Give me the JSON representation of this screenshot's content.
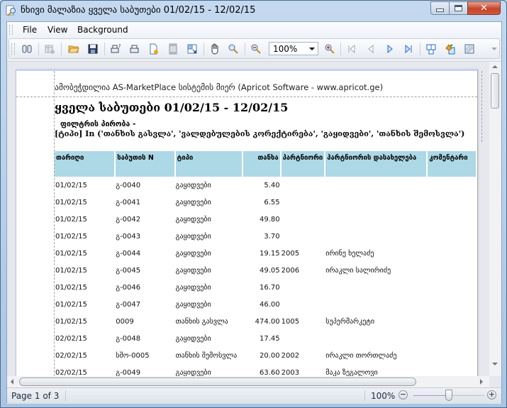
{
  "window": {
    "title": "ნხივი მალაზია ყველა საბუთები 01/02/15 - 12/02/15",
    "minimize_label": "minimize",
    "maximize_label": "maximize",
    "close_label": "✕"
  },
  "menu": {
    "items": [
      {
        "label": "File"
      },
      {
        "label": "View"
      },
      {
        "label": "Background"
      }
    ]
  },
  "toolbar": {
    "zoom_value": "100%",
    "icons": [
      "find-icon",
      "parameters-icon",
      "open-icon",
      "save-icon",
      "print-dialog-icon",
      "quick-print-icon",
      "page-setup-icon",
      "header-footer-icon",
      "scale-icon",
      "hand-tool-icon",
      "magnifier-icon",
      "zoom-out-icon",
      "zoom-in-icon",
      "first-page-icon",
      "previous-page-icon",
      "next-page-icon",
      "last-page-icon",
      "multiple-pages-icon",
      "background-color-icon",
      "watermark-icon"
    ]
  },
  "report": {
    "generated_by": "ამობეჭდილია AS-MarketPlace სისტემის მიერ (Apricot Software - www.apricot.ge)",
    "title": "ყველა საბუთები 01/02/15 - 12/02/15",
    "filter_label": "ფილტრის პირობა  -",
    "filter_expression": "[ტიპი] In ('თანხის გასვლა', 'ვალდებულების კორექტირება', 'გაყიდვები', 'თანხის შემოსვლა')",
    "columns": [
      "თარიღი",
      "საბუთის N",
      "ტიპი",
      "თანხა",
      "პარტნიორი",
      "პარტნიორის დასახელება",
      "კომენტარი"
    ],
    "rows": [
      {
        "date": "01/02/15",
        "doc_no": "გ-0040",
        "type": "გაყიდვები",
        "amount": "5.40",
        "partner": "",
        "partner_name": "",
        "comment": ""
      },
      {
        "date": "01/02/15",
        "doc_no": "გ-0041",
        "type": "გაყიდვები",
        "amount": "6.55",
        "partner": "",
        "partner_name": "",
        "comment": ""
      },
      {
        "date": "01/02/15",
        "doc_no": "გ-0042",
        "type": "გაყიდვები",
        "amount": "49.80",
        "partner": "",
        "partner_name": "",
        "comment": ""
      },
      {
        "date": "01/02/15",
        "doc_no": "გ-0043",
        "type": "გაყიდვები",
        "amount": "3.70",
        "partner": "",
        "partner_name": "",
        "comment": ""
      },
      {
        "date": "01/02/15",
        "doc_no": "გ-0044",
        "type": "გაყიდვები",
        "amount": "19.15",
        "partner": "2005",
        "partner_name": "ირინე ხელაძე",
        "comment": ""
      },
      {
        "date": "01/02/15",
        "doc_no": "გ-0045",
        "type": "გაყიდვები",
        "amount": "49.05",
        "partner": "2006",
        "partner_name": "ირაკლი სალირიძე",
        "comment": ""
      },
      {
        "date": "01/02/15",
        "doc_no": "გ-0046",
        "type": "გაყიდვები",
        "amount": "16.70",
        "partner": "",
        "partner_name": "",
        "comment": ""
      },
      {
        "date": "01/02/15",
        "doc_no": "გ-0047",
        "type": "გაყიდვები",
        "amount": "46.00",
        "partner": "",
        "partner_name": "",
        "comment": ""
      },
      {
        "date": "01/02/15",
        "doc_no": "0009",
        "type": "თანხის გასვლა",
        "amount": "474.00",
        "partner": "1005",
        "partner_name": "სუპერმარკეტი",
        "comment": ""
      },
      {
        "date": "02/02/15",
        "doc_no": "გ-0048",
        "type": "გაყიდვები",
        "amount": "17.45",
        "partner": "",
        "partner_name": "",
        "comment": ""
      },
      {
        "date": "02/02/15",
        "doc_no": "სშო-0005",
        "type": "თანხის შემოსვლა",
        "amount": "20.00",
        "partner": "2002",
        "partner_name": "ირაკლი თორთლაძე",
        "comment": ""
      },
      {
        "date": "02/02/15",
        "doc_no": "გ-0049",
        "type": "გაყიდვები",
        "amount": "63.60",
        "partner": "2003",
        "partner_name": "მაკა ზეგალოვი",
        "comment": ""
      }
    ]
  },
  "statusbar": {
    "page_info": "Page 1 of 3",
    "zoom_percent": "100%",
    "zoom_level_fraction": 0.5,
    "zoom_out_label": "−",
    "zoom_in_label": "+"
  },
  "colors": {
    "header_bg": "#add8e6",
    "close_button": "#c6452c"
  }
}
